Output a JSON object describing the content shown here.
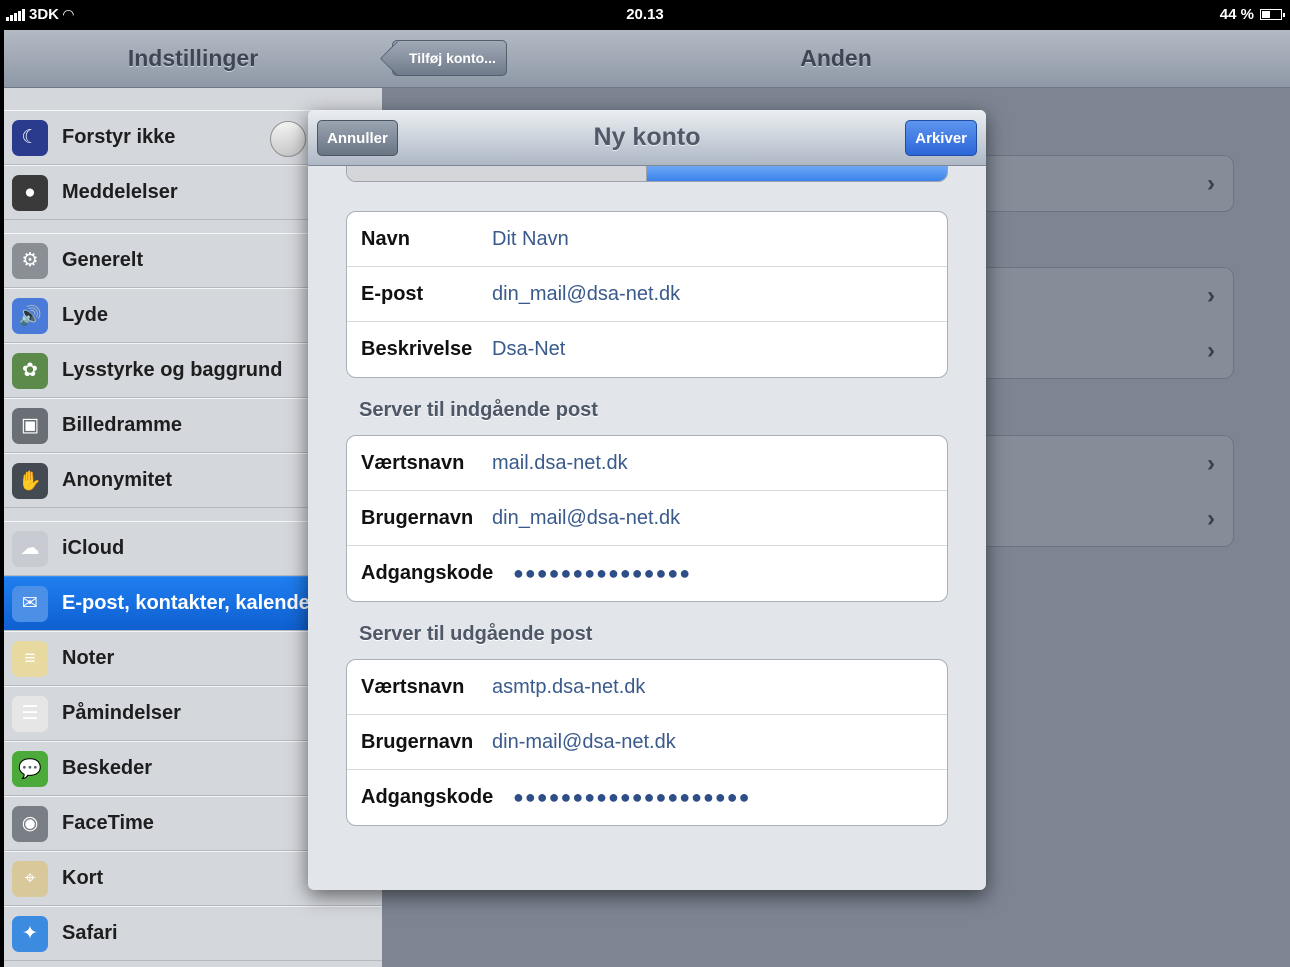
{
  "status": {
    "carrier": "3DK",
    "time": "20.13",
    "battery": "44 %"
  },
  "settings": {
    "title": "Indstillinger",
    "items": [
      {
        "label": "Forstyr ikke",
        "icon": "moon-icon",
        "color": "#2a3a8c",
        "glyph": "☾"
      },
      {
        "label": "Meddelelser",
        "icon": "notifications-icon",
        "color": "#3a3a3a",
        "glyph": "●"
      },
      {
        "label": "Generelt",
        "icon": "gear-icon",
        "color": "#8a8f96",
        "glyph": "⚙"
      },
      {
        "label": "Lyde",
        "icon": "speaker-icon",
        "color": "#4a7bd8",
        "glyph": "🔊"
      },
      {
        "label": "Lysstyrke og baggrund",
        "icon": "brightness-icon",
        "color": "#5c8a4a",
        "glyph": "✿"
      },
      {
        "label": "Billedramme",
        "icon": "picture-frame-icon",
        "color": "#6a6f76",
        "glyph": "▣"
      },
      {
        "label": "Anonymitet",
        "icon": "hand-icon",
        "color": "#444a52",
        "glyph": "✋"
      },
      {
        "label": "iCloud",
        "icon": "cloud-icon",
        "color": "#c8ccd2",
        "glyph": "☁"
      },
      {
        "label": "E-post, kontakter, kalender",
        "icon": "mail-icon",
        "color": "#4c8fe6",
        "glyph": "✉"
      },
      {
        "label": "Noter",
        "icon": "notes-icon",
        "color": "#e8d9a0",
        "glyph": "≡"
      },
      {
        "label": "Påmindelser",
        "icon": "reminders-icon",
        "color": "#e6e6e6",
        "glyph": "☰"
      },
      {
        "label": "Beskeder",
        "icon": "messages-icon",
        "color": "#4caa3a",
        "glyph": "💬"
      },
      {
        "label": "FaceTime",
        "icon": "facetime-icon",
        "color": "#7a7f86",
        "glyph": "◉"
      },
      {
        "label": "Kort",
        "icon": "maps-icon",
        "color": "#d8c89a",
        "glyph": "⌖"
      },
      {
        "label": "Safari",
        "icon": "safari-icon",
        "color": "#3b8be0",
        "glyph": "✦"
      }
    ]
  },
  "detail": {
    "back_label": "Tilføj konto...",
    "title": "Anden"
  },
  "modal": {
    "title": "Ny konto",
    "cancel": "Annuller",
    "save": "Arkiver",
    "account": [
      {
        "key": "Navn",
        "value": "Dit Navn"
      },
      {
        "key": "E-post",
        "value": "din_mail@dsa-net.dk"
      },
      {
        "key": "Beskrivelse",
        "value": "Dsa-Net"
      }
    ],
    "incoming_label": "Server til indgående post",
    "incoming": [
      {
        "key": "Værtsnavn",
        "value": "mail.dsa-net.dk"
      },
      {
        "key": "Brugernavn",
        "value": "din_mail@dsa-net.dk"
      },
      {
        "key": "Adgangskode",
        "value": "●●●●●●●●●●●●●●●"
      }
    ],
    "outgoing_label": "Server til udgående post",
    "outgoing": [
      {
        "key": "Værtsnavn",
        "value": "asmtp.dsa-net.dk"
      },
      {
        "key": "Brugernavn",
        "value": "din-mail@dsa-net.dk"
      },
      {
        "key": "Adgangskode",
        "value": "●●●●●●●●●●●●●●●●●●●●"
      }
    ]
  }
}
